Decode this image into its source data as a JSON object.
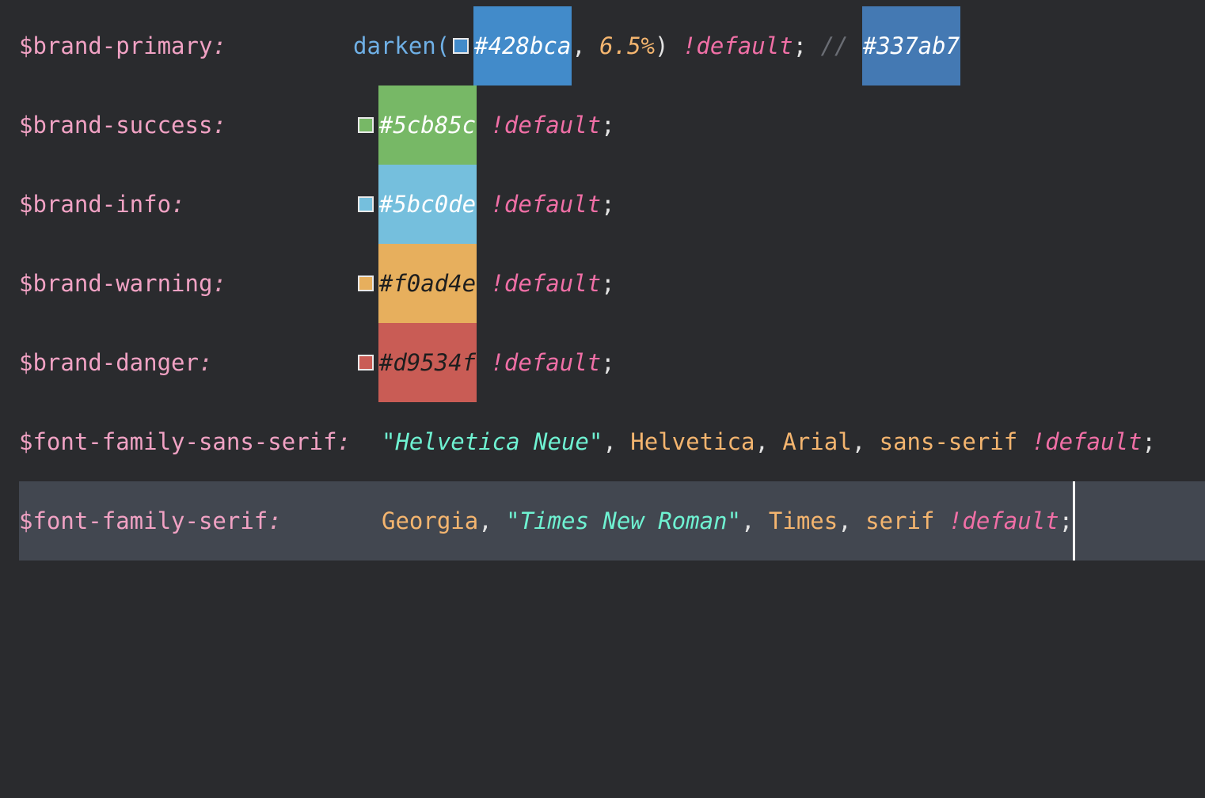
{
  "lines": [
    {
      "name": "$brand-primary",
      "func": "darken(",
      "swatch_color": "#428bca",
      "hex": "#428bca",
      "comma": ",",
      "amount": "6.5%",
      "close": ")",
      "bang": "!default",
      "semicolon": ";",
      "comment_marker": "//",
      "result_hex": "#337ab7",
      "result_color": "#4479b3"
    },
    {
      "name": "$brand-success",
      "hex": "#5cb85c",
      "color": "#77b866",
      "bang": "!default",
      "semicolon": ";"
    },
    {
      "name": "$brand-info",
      "hex": "#5bc0de",
      "color": "#75bfdd",
      "bang": "!default",
      "semicolon": ";"
    },
    {
      "name": "$brand-warning",
      "hex": "#f0ad4e",
      "color": "#e7af5d",
      "bang": "!default",
      "semicolon": ";"
    },
    {
      "name": "$brand-danger",
      "hex": "#d9534f",
      "color": "#c95c55",
      "bang": "!default",
      "semicolon": ";"
    }
  ],
  "sans": {
    "name": "$font-family-sans-serif",
    "str": "\"Helvetica Neue\"",
    "f1": "Helvetica",
    "f2": "Arial",
    "f3": "sans-serif",
    "bang": "!default",
    "semicolon": ";",
    "sep": ","
  },
  "serif": {
    "name": "$font-family-serif",
    "f1": "Georgia",
    "str": "\"Times New Roman\"",
    "f2": "Times",
    "f3": "serif",
    "bang": "!default",
    "semicolon": ";",
    "sep": ","
  },
  "colon": ":"
}
